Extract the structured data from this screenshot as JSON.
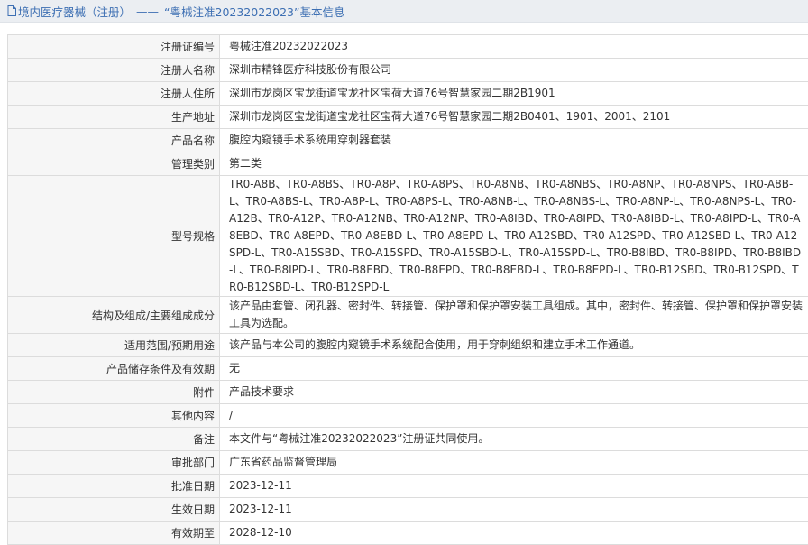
{
  "header": {
    "category": "境内医疗器械（注册）",
    "separator": "——",
    "title": "“粤械注准20232022023”基本信息"
  },
  "colors": {
    "header_text": "#3d6fb3",
    "label_bg": "#f6f6f6",
    "border": "#dcdcdc"
  },
  "rows": [
    {
      "label": "注册证编号",
      "value": "粤械注准20232022023"
    },
    {
      "label": "注册人名称",
      "value": "深圳市精锋医疗科技股份有限公司"
    },
    {
      "label": "注册人住所",
      "value": "深圳市龙岗区宝龙街道宝龙社区宝荷大道76号智慧家园二期2B1901"
    },
    {
      "label": "生产地址",
      "value": "深圳市龙岗区宝龙街道宝龙社区宝荷大道76号智慧家园二期2B0401、1901、2001、2101"
    },
    {
      "label": "产品名称",
      "value": "腹腔内窥镜手术系统用穿刺器套装"
    },
    {
      "label": "管理类别",
      "value": "第二类"
    },
    {
      "label": "型号规格",
      "value": "TR0-A8B、TR0-A8BS、TR0-A8P、TR0-A8PS、TR0-A8NB、TR0-A8NBS、TR0-A8NP、TR0-A8NPS、TR0-A8B-L、TR0-A8BS-L、TR0-A8P-L、TR0-A8PS-L、TR0-A8NB-L、TR0-A8NBS-L、TR0-A8NP-L、TR0-A8NPS-L、TR0-A12B、TR0-A12P、TR0-A12NB、TR0-A12NP、TR0-A8IBD、TR0-A8IPD、TR0-A8IBD-L、TR0-A8IPD-L、TR0-A8EBD、TR0-A8EPD、TR0-A8EBD-L、TR0-A8EPD-L、TR0-A12SBD、TR0-A12SPD、TR0-A12SBD-L、TR0-A12SPD-L、TR0-A15SBD、TR0-A15SPD、TR0-A15SBD-L、TR0-A15SPD-L、TR0-B8IBD、TR0-B8IPD、TR0-B8IBD-L、TR0-B8IPD-L、TR0-B8EBD、TR0-B8EPD、TR0-B8EBD-L、TR0-B8EPD-L、TR0-B12SBD、TR0-B12SPD、TR0-B12SBD-L、TR0-B12SPD-L"
    },
    {
      "label": "结构及组成/主要组成成分",
      "value": "该产品由套管、闭孔器、密封件、转接管、保护罩和保护罩安装工具组成。其中，密封件、转接管、保护罩和保护罩安装工具为选配。"
    },
    {
      "label": "适用范围/预期用途",
      "value": "该产品与本公司的腹腔内窥镜手术系统配合使用，用于穿刺组织和建立手术工作通道。"
    },
    {
      "label": "产品储存条件及有效期",
      "value": "无"
    },
    {
      "label": "附件",
      "value": "产品技术要求"
    },
    {
      "label": "其他内容",
      "value": "/"
    },
    {
      "label": "备注",
      "value": "本文件与“粤械注准20232022023”注册证共同使用。"
    },
    {
      "label": "审批部门",
      "value": "广东省药品监督管理局"
    },
    {
      "label": "批准日期",
      "value": "2023-12-11"
    },
    {
      "label": "生效日期",
      "value": "2023-12-11"
    },
    {
      "label": "有效期至",
      "value": "2028-12-10"
    }
  ]
}
